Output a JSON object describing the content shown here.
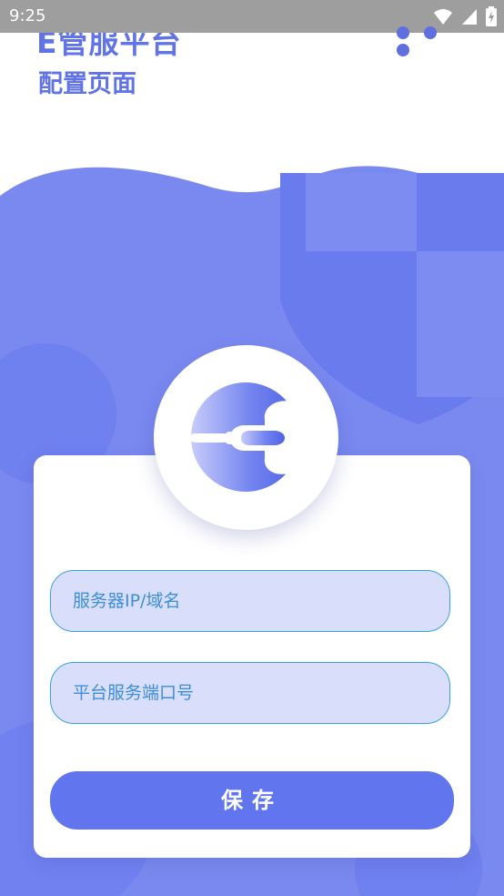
{
  "status_bar": {
    "time": "9:25",
    "icons": [
      "wifi-icon",
      "cellular-signal-icon",
      "battery-icon"
    ]
  },
  "header": {
    "title": "E管服平台",
    "subtitle": "配置页面",
    "more_icon": "more-dots-icon"
  },
  "form": {
    "server_field": {
      "placeholder": "服务器IP/域名",
      "value": ""
    },
    "port_field": {
      "placeholder": "平台服务端口号",
      "value": ""
    },
    "save_label": "保存"
  },
  "colors": {
    "accent": "#6074e6",
    "background_blue": "#7a89f0",
    "field_fill": "#d9defa",
    "field_border": "#3aa0e0",
    "button": "#6175ee",
    "status_bar": "#9e9e9e"
  }
}
